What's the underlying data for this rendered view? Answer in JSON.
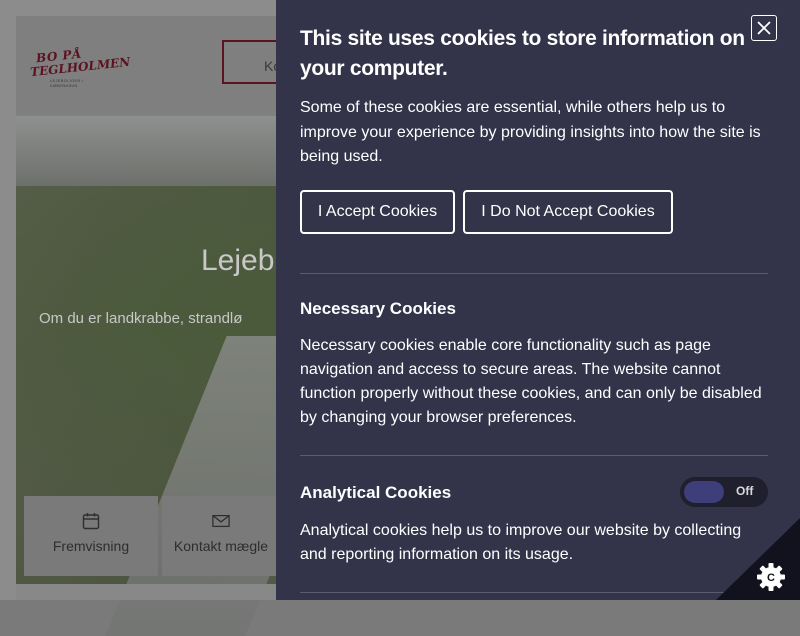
{
  "site": {
    "logo_line1": "BO PÅ",
    "logo_line2": "TEGLHOLMEN",
    "logo_tagline": "LEJEBOLIGER I KØBENHAVN",
    "header_button_label": "Ko",
    "hero_title": "Lejeb",
    "hero_subtitle": "Om du er landkrabbe, strandlø",
    "tiles": [
      {
        "label": "Fremvisning",
        "icon": "calendar-icon"
      },
      {
        "label": "Kontakt mægle",
        "icon": "mail-icon"
      }
    ]
  },
  "cookie_panel": {
    "title": "This site uses cookies to store information on your computer.",
    "intro": "Some of these cookies are essential, while others help us to improve your experience by providing insights into how the site is being used.",
    "accept_label": "I Accept Cookies",
    "decline_label": "I Do Not Accept Cookies",
    "necessary": {
      "title": "Necessary Cookies",
      "text": "Necessary cookies enable core functionality such as page navigation and access to secure areas. The website cannot function properly without these cookies, and can only be disabled by changing your browser preferences."
    },
    "analytical": {
      "title": "Analytical Cookies",
      "text": "Analytical cookies help us to improve our website by collecting and reporting information on its usage.",
      "toggle_state": "Off"
    },
    "close_icon": "close-icon",
    "badge_icon": "cookie-gear-icon"
  },
  "colors": {
    "panel_background": "#33334a",
    "brand_accent": "#5c1220",
    "toggle_knob": "#3e3e7a"
  }
}
